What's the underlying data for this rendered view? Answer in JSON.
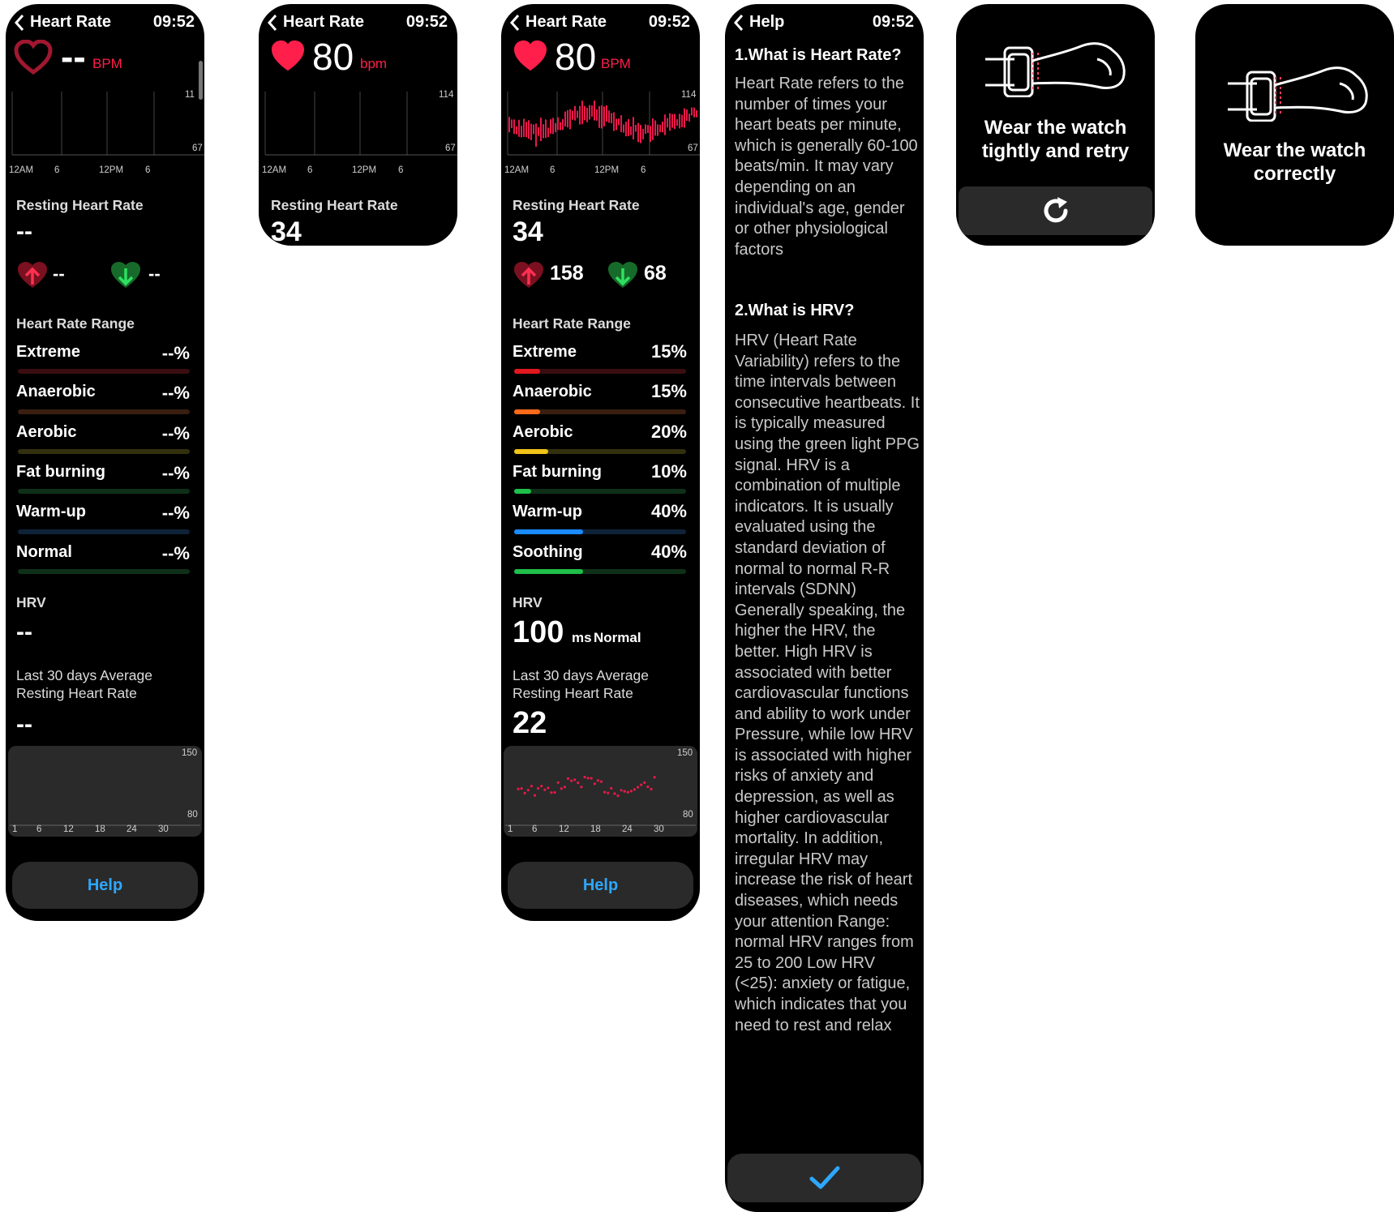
{
  "colors": {
    "accent_red": "#ff1f4a",
    "link_blue": "#2ea7ff",
    "extreme": "#e0191f",
    "anaerobic": "#ff6a1a",
    "aerobic": "#f0c418",
    "fat_burning": "#1fbf4a",
    "warm_up": "#1a8bff",
    "normal": "#1fbf4a"
  },
  "screen1": {
    "title": "Heart Rate",
    "time": "09:52",
    "hr_value": "--",
    "hr_unit": "BPM",
    "chart_y_top": "11",
    "chart_y_bottom": "67",
    "chart_x": [
      "12AM",
      "6",
      "12PM",
      "6"
    ],
    "resting_label": "Resting Heart Rate",
    "resting_value": "--",
    "max_value": "--",
    "min_value": "--",
    "range_label": "Heart Rate Range",
    "zones": [
      {
        "name": "Extreme",
        "value": "--%"
      },
      {
        "name": "Anaerobic",
        "value": "--%"
      },
      {
        "name": "Aerobic",
        "value": "--%"
      },
      {
        "name": "Fat burning",
        "value": "--%"
      },
      {
        "name": "Warm-up",
        "value": "--%"
      },
      {
        "name": "Normal",
        "value": "--%"
      }
    ],
    "hrv_label": "HRV",
    "hrv_value": "--",
    "avg_label_1": "Last 30 days Average",
    "avg_label_2": "Resting Heart Rate",
    "avg_value": "--",
    "mini_y_top": "150",
    "mini_y_bottom": "80",
    "mini_x": [
      "1",
      "6",
      "12",
      "18",
      "24",
      "30"
    ],
    "help_label": "Help"
  },
  "screen2": {
    "title": "Heart Rate",
    "time": "09:52",
    "hr_value": "80",
    "hr_unit": "bpm",
    "chart_y_top": "114",
    "chart_y_bottom": "67",
    "chart_x": [
      "12AM",
      "6",
      "12PM",
      "6"
    ],
    "resting_label": "Resting Heart Rate",
    "resting_value": "34"
  },
  "screen3": {
    "title": "Heart Rate",
    "time": "09:52",
    "hr_value": "80",
    "hr_unit": "BPM",
    "chart_y_top": "114",
    "chart_y_bottom": "67",
    "chart_x": [
      "12AM",
      "6",
      "12PM",
      "6"
    ],
    "resting_label": "Resting Heart Rate",
    "resting_value": "34",
    "max_value": "158",
    "min_value": "68",
    "range_label": "Heart Rate Range",
    "zones": [
      {
        "name": "Extreme",
        "value": "15%",
        "pct": 15
      },
      {
        "name": "Anaerobic",
        "value": "15%",
        "pct": 15
      },
      {
        "name": "Aerobic",
        "value": "20%",
        "pct": 20
      },
      {
        "name": "Fat burning",
        "value": "10%",
        "pct": 10
      },
      {
        "name": "Warm-up",
        "value": "40%",
        "pct": 40
      },
      {
        "name": "Soothing",
        "value": "40%",
        "pct": 40
      }
    ],
    "hrv_label": "HRV",
    "hrv_value": "100",
    "hrv_unit": "ms",
    "hrv_status": "Normal",
    "avg_label_1": "Last 30 days Average",
    "avg_label_2": "Resting Heart Rate",
    "avg_value": "22",
    "mini_y_top": "150",
    "mini_y_bottom": "80",
    "mini_x": [
      "1",
      "6",
      "12",
      "18",
      "24",
      "30"
    ],
    "help_label": "Help"
  },
  "screen4": {
    "title": "Help",
    "time": "09:52",
    "q1": "1.What is Heart Rate?",
    "a1": "Heart Rate refers to the number of times your heart beats per minute, which is generally 60-100 beats/min. It may vary depending on an individual's age, gender or other physiological factors",
    "q2": "2.What is HRV?",
    "a2": "HRV (Heart Rate Variability) refers to the time intervals between consecutive heartbeats. It is typically measured using the green light PPG signal. HRV is a combination of multiple indicators. It is usually evaluated using the standard deviation of normal to normal R-R intervals (SDNN) Generally speaking, the higher the HRV, the better. High HRV is associated with better cardiovascular functions and ability to work under Pressure, while low HRV is associated with higher risks of anxiety and depression, as well as higher cardiovascular mortality. In addition, irregular HRV may increase the risk of heart diseases, which needs your attention Range: normal HRV ranges from 25 to 200 Low HRV (<25): anxiety or fatigue, which indicates that you need to rest and relax"
  },
  "screen5": {
    "line1": "Wear the watch",
    "line2": "tightly and retry"
  },
  "screen6": {
    "line1": "Wear the watch",
    "line2": "correctly"
  }
}
